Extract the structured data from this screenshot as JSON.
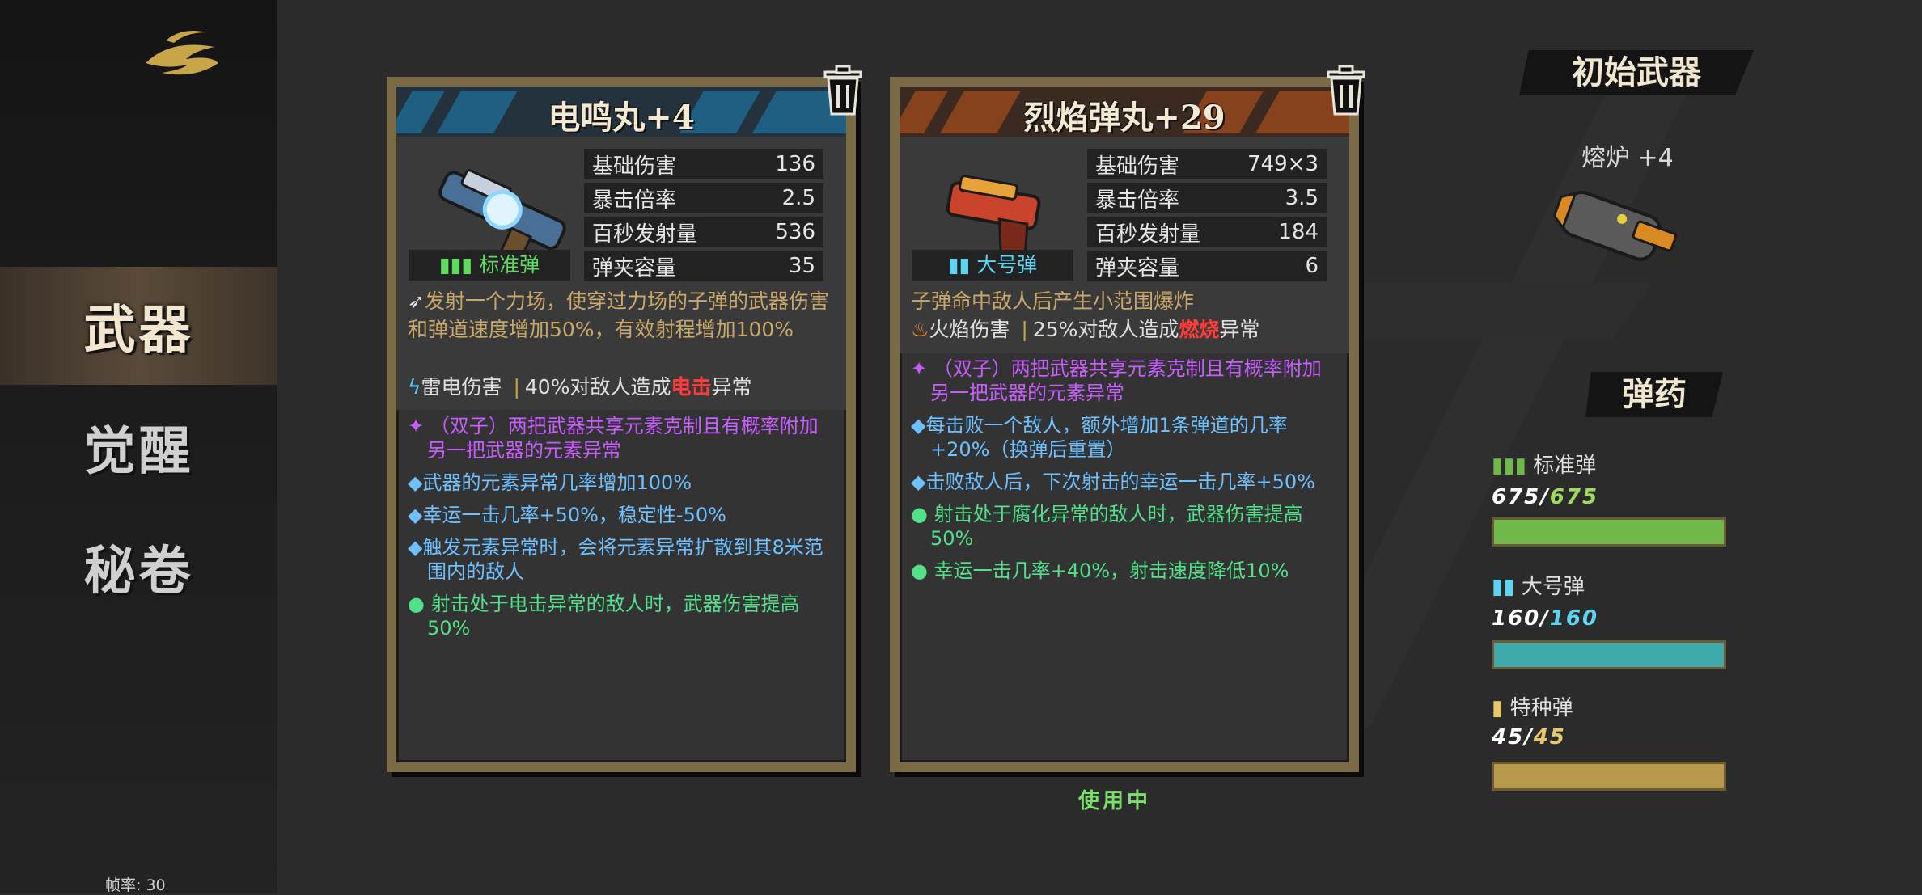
{
  "sidebar": {
    "nav": [
      {
        "label": "武器",
        "active": true
      },
      {
        "label": "觉醒",
        "active": false
      },
      {
        "label": "秘卷",
        "active": false
      }
    ],
    "fps_label": "帧率: 30"
  },
  "cards": [
    {
      "title": "电鸣丸+4",
      "accent": "#1e6f9a",
      "ammo_type": "标准弹",
      "ammo_color": "#5fdc5f",
      "stats": [
        {
          "label": "基础伤害",
          "value": "136"
        },
        {
          "label": "暴击倍率",
          "value": "2.5"
        },
        {
          "label": "百秒发射量",
          "value": "536"
        },
        {
          "label": "弹夹容量",
          "value": "35"
        }
      ],
      "description": "发射一个力场，使穿过力场的子弹的武器伤害和弹道速度增加50%，有效射程增加100%",
      "element_label": "雷电伤害",
      "effect_prefix": "40%对敌人造成",
      "effect_keyword": "电击",
      "effect_suffix": "异常",
      "bullets": [
        {
          "icon": "✦",
          "color": "#c95cff",
          "text": "（双子）两把武器共享元素克制且有概率附加另一把武器的元素异常"
        },
        {
          "icon": "◆",
          "color": "#6ec0ff",
          "text": "武器的元素异常几率增加100%"
        },
        {
          "icon": "◆",
          "color": "#6ec0ff",
          "text": "幸运一击几率+50%，稳定性-50%"
        },
        {
          "icon": "◆",
          "color": "#6ec0ff",
          "text": "触发元素异常时，会将元素异常扩散到其8米范围内的敌人"
        },
        {
          "icon": "●",
          "color": "#52e08a",
          "text": "射击处于电击异常的敌人时，武器伤害提高50%"
        }
      ]
    },
    {
      "title": "烈焰弹丸+29",
      "accent": "#a04a1c",
      "ammo_type": "大号弹",
      "ammo_color": "#5fd4f0",
      "stats": [
        {
          "label": "基础伤害",
          "value": "749×3"
        },
        {
          "label": "暴击倍率",
          "value": "3.5"
        },
        {
          "label": "百秒发射量",
          "value": "184"
        },
        {
          "label": "弹夹容量",
          "value": "6"
        }
      ],
      "description": "子弹命中敌人后产生小范围爆炸",
      "element_label": "火焰伤害",
      "effect_prefix": "25%对敌人造成",
      "effect_keyword": "燃烧",
      "effect_suffix": "异常",
      "bullets": [
        {
          "icon": "✦",
          "color": "#c95cff",
          "text": "（双子）两把武器共享元素克制且有概率附加另一把武器的元素异常"
        },
        {
          "icon": "◆",
          "color": "#6ec0ff",
          "text": "每击败一个敌人，额外增加1条弹道的几率+20%（换弹后重置）"
        },
        {
          "icon": "◆",
          "color": "#6ec0ff",
          "text": "击败敌人后，下次射击的幸运一击几率+50%"
        },
        {
          "icon": "●",
          "color": "#52e08a",
          "text": "射击处于腐化异常的敌人时，武器伤害提高50%"
        },
        {
          "icon": "●",
          "color": "#52e08a",
          "text": "幸运一击几率+40%，射击速度降低10%"
        }
      ],
      "status": "使用中"
    }
  ],
  "initial_weapon": {
    "heading": "初始武器",
    "name": "熔炉 +4"
  },
  "ammo": {
    "heading": "弹药",
    "types": [
      {
        "name": "标准弹",
        "current": "675",
        "max": "675",
        "color": "#6fb84a",
        "fraction": 1.0
      },
      {
        "name": "大号弹",
        "current": "160",
        "max": "160",
        "color": "#3fa9a9",
        "fraction": 1.0
      },
      {
        "name": "特种弹",
        "current": "45",
        "max": "45",
        "color": "#b8984a",
        "fraction": 1.0
      }
    ]
  }
}
